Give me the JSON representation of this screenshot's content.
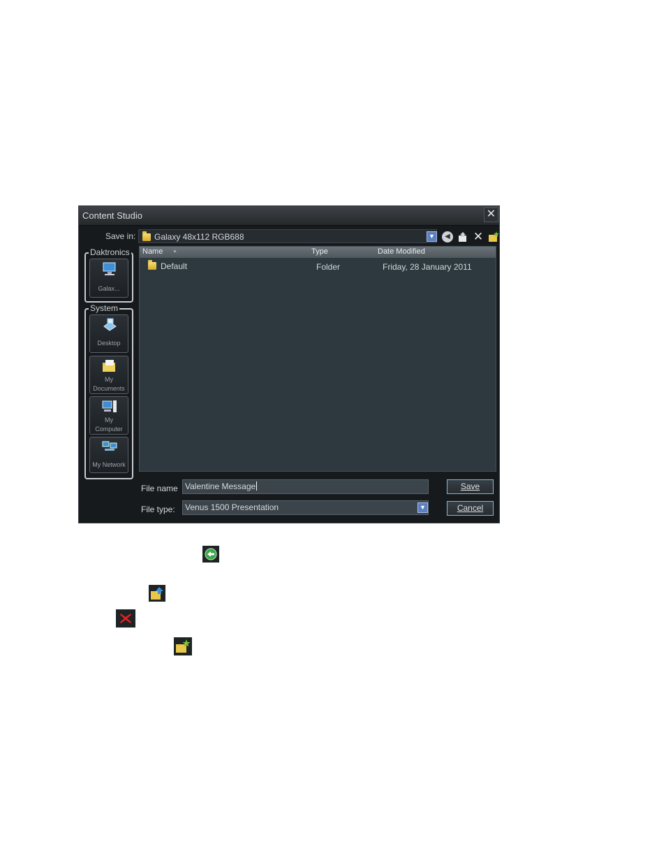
{
  "window": {
    "title": "Content Studio"
  },
  "toolbar": {
    "save_in_label": "Save in:",
    "save_in_value": "Galaxy 48x112 RGB688",
    "icons": [
      "folder-icon",
      "dropdown-icon",
      "back-icon",
      "up-folder-icon",
      "delete-icon",
      "new-folder-icon"
    ]
  },
  "places": {
    "groups": [
      {
        "label": "Daktronics",
        "items": [
          {
            "label": "Galax...",
            "icon": "monitor-icon"
          }
        ]
      },
      {
        "label": "System",
        "items": [
          {
            "label": "Desktop",
            "icon": "desktop-icon"
          },
          {
            "label_line1": "My",
            "label_line2": "Documents",
            "icon": "documents-icon"
          },
          {
            "label_line1": "My",
            "label_line2": "Computer",
            "icon": "computer-icon"
          },
          {
            "label": "My Network",
            "icon": "network-icon"
          }
        ]
      }
    ]
  },
  "file_list": {
    "columns": [
      "Name",
      "Type",
      "Date Modified"
    ],
    "rows": [
      {
        "name": "Default",
        "type": "Folder",
        "date": "Friday, 28 January 2011"
      }
    ]
  },
  "footer": {
    "file_name_label": "File name",
    "file_name_value": "Valentine Message",
    "file_type_label": "File type:",
    "file_type_value": "Venus 1500 Presentation",
    "save_label": "Save",
    "cancel_label": "Cancel"
  },
  "legend_icons": [
    "back-icon",
    "up-folder-icon",
    "delete-icon",
    "new-folder-icon"
  ],
  "colors": {
    "dialog_bg": "#161a1d",
    "list_bg": "#2d393f",
    "button_border": "#8fb5d5",
    "delete_red": "#e0221f"
  }
}
